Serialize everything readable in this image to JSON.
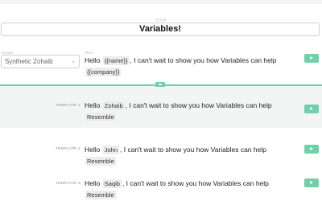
{
  "header": {
    "title_label": "TITLE",
    "title_value": "Variables!"
  },
  "editor": {
    "voice_label": "VOICE",
    "voice_value": "Synthetic Zohaib",
    "text_label": "TEXT",
    "text_prefix": "Hello",
    "var_name": "{{name}}",
    "text_middle": ", I can't wait to show you how Variables can help",
    "var_company": "{{company}}"
  },
  "templates": [
    {
      "label": "TEMPLATE 1",
      "prefix": "Hello",
      "name": "Zohaib",
      "middle": ", I can't wait to show you how Variables can help",
      "company": "Resemble"
    },
    {
      "label": "TEMPLATE 2",
      "prefix": "Hello",
      "name": "John",
      "middle": ", I can't wait to show you how Variables can help",
      "company": "Resemble"
    },
    {
      "label": "TEMPLATE 3",
      "prefix": "Hello",
      "name": "Saqib",
      "middle": ", I can't wait to show you how Variables can help",
      "company": "Resemble"
    }
  ],
  "colors": {
    "accent": "#6fd1a9",
    "shade": "#f3f4f4"
  },
  "icons": {
    "play": "play-icon",
    "chevron": "chevron-down-icon",
    "divider": "divider-handle-icon"
  }
}
